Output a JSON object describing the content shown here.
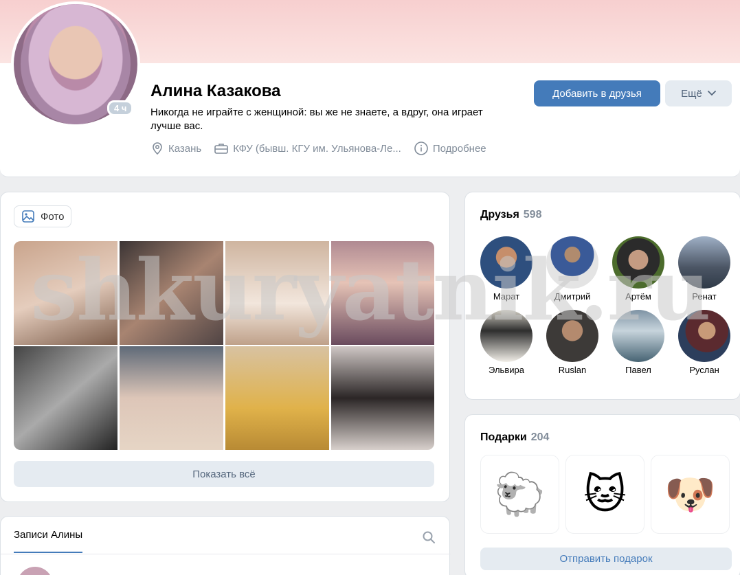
{
  "profile": {
    "name": "Алина Казакова",
    "status": "Никогда не играйте с женщиной: вы же не знаете, а вдруг, она играет лучше вас.",
    "online": "4 ч",
    "city": "Казань",
    "university": "КФУ (бывш. КГУ им. Ульянова-Ле...",
    "more_info": "Подробнее",
    "add_friend": "Добавить в друзья",
    "more": "Ещё"
  },
  "photos": {
    "tab": "Фото",
    "show_all": "Показать всё"
  },
  "wall": {
    "tab": "Записи Алины"
  },
  "friends": {
    "title": "Друзья",
    "count": "598",
    "items": [
      {
        "name": "Марат"
      },
      {
        "name": "Дмитрий"
      },
      {
        "name": "Артём"
      },
      {
        "name": "Ренат"
      },
      {
        "name": "Эльвира"
      },
      {
        "name": "Ruslan"
      },
      {
        "name": "Павел"
      },
      {
        "name": "Руслан"
      }
    ]
  },
  "gifts": {
    "title": "Подарки",
    "count": "204",
    "items": [
      "🐑",
      "🐱",
      "🐶"
    ],
    "send": "Отправить подарок"
  },
  "watermark": "shkuryatnik.ru",
  "colors": {
    "accent": "#447bba",
    "secondary_button": "#e5ebf1",
    "muted_text": "#818c99",
    "background": "#edeef0"
  }
}
